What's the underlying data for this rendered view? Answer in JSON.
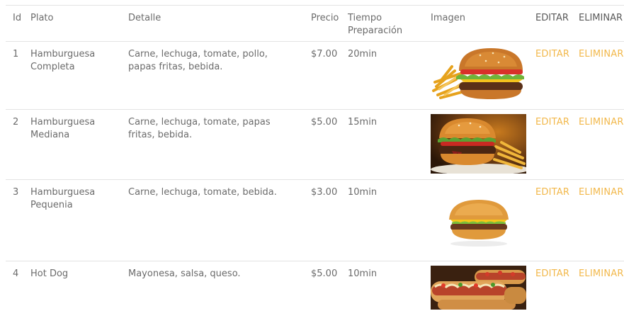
{
  "table": {
    "headers": {
      "id": "Id",
      "plato": "Plato",
      "detalle": "Detalle",
      "precio": "Precio",
      "tiempo": "Tiempo Preparación",
      "imagen": "Imagen",
      "editar": "EDITAR",
      "eliminar": "ELIMINAR"
    },
    "rows": [
      {
        "id": "1",
        "plato": "Hamburguesa Completa",
        "detalle": "Carne, lechuga, tomate, pollo, papas fritas, bebida.",
        "precio": "$7.00",
        "tiempo": "20min",
        "image_icon": "burger-with-fries-icon",
        "editar": "EDITAR",
        "eliminar": "ELIMINAR"
      },
      {
        "id": "2",
        "plato": "Hamburguesa Mediana",
        "detalle": "Carne, lechuga, tomate, papas fritas, bebida.",
        "precio": "$5.00",
        "tiempo": "15min",
        "image_icon": "burger-dark-background-icon",
        "editar": "EDITAR",
        "eliminar": "ELIMINAR"
      },
      {
        "id": "3",
        "plato": "Hamburguesa Pequenia",
        "detalle": "Carne, lechuga, tomate, bebida.",
        "precio": "$3.00",
        "tiempo": "10min",
        "image_icon": "small-burger-icon",
        "editar": "EDITAR",
        "eliminar": "ELIMINAR"
      },
      {
        "id": "4",
        "plato": "Hot Dog",
        "detalle": "Mayonesa, salsa, queso.",
        "precio": "$5.00",
        "tiempo": "10min",
        "image_icon": "hot-dog-icon",
        "editar": "EDITAR",
        "eliminar": "ELIMINAR"
      }
    ]
  },
  "colors": {
    "action": "#f2b84b",
    "text": "#6b6b6b",
    "border": "#e3e3e3"
  }
}
